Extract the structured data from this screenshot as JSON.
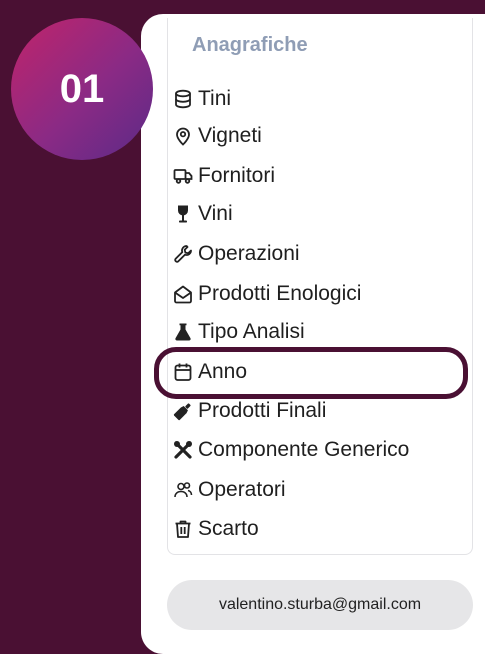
{
  "badge": {
    "number": "01"
  },
  "menu": {
    "section_title": "Anagrafiche",
    "items": [
      {
        "label": "Tini",
        "icon": "database-icon"
      },
      {
        "label": "Vigneti",
        "icon": "map-pin-icon"
      },
      {
        "label": "Fornitori",
        "icon": "truck-icon"
      },
      {
        "label": "Vini",
        "icon": "wine-glass-icon"
      },
      {
        "label": "Operazioni",
        "icon": "wrench-icon"
      },
      {
        "label": "Prodotti Enologici",
        "icon": "mail-open-icon"
      },
      {
        "label": "Tipo Analisi",
        "icon": "flask-icon"
      },
      {
        "label": "Anno",
        "icon": "calendar-icon"
      },
      {
        "label": "Prodotti Finali",
        "icon": "bottle-icon"
      },
      {
        "label": "Componente Generico",
        "icon": "tools-icon"
      },
      {
        "label": "Operatori",
        "icon": "users-icon"
      },
      {
        "label": "Scarto",
        "icon": "trash-icon"
      }
    ]
  },
  "user": {
    "email": "valentino.sturba@gmail.com"
  },
  "colors": {
    "background": "#4a1033",
    "section_title": "#8f9db5",
    "highlight_border": "#4a1033",
    "user_pill": "#e6e6e8"
  }
}
